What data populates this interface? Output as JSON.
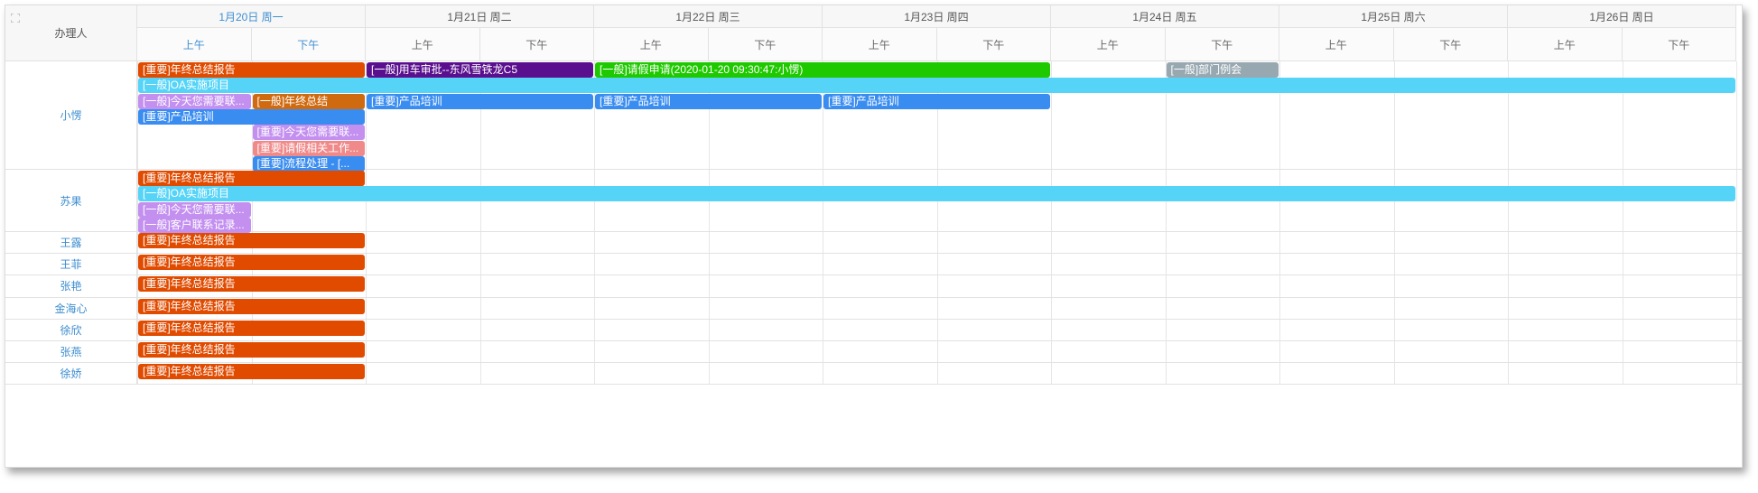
{
  "header": {
    "assignee_label": "办理人",
    "days": [
      {
        "label": "1月20日 周一",
        "today": true
      },
      {
        "label": "1月21日 周二",
        "today": false
      },
      {
        "label": "1月22日 周三",
        "today": false
      },
      {
        "label": "1月23日 周四",
        "today": false
      },
      {
        "label": "1月24日 周五",
        "today": false
      },
      {
        "label": "1月25日 周六",
        "today": false
      },
      {
        "label": "1月26日 周日",
        "today": false
      }
    ],
    "am_label": "上午",
    "pm_label": "下午"
  },
  "colors": {
    "important_orange": "#e04b00",
    "deep_purple": "#5a0f8e",
    "green": "#1fc900",
    "gray": "#97a8b0",
    "cyan": "#56d4f8",
    "lavender": "#c390f0",
    "brown_orange": "#d06a10",
    "blue": "#3a8df0",
    "pink": "#f08a8a",
    "today_blue": "#3e8ed0"
  },
  "people": [
    {
      "name": "小愣",
      "events": [
        {
          "text": "[重要]年终总结报告",
          "start": 0,
          "span": 2,
          "lane": 0,
          "color": "important_orange"
        },
        {
          "text": "[一般]用车审批--东风雪铁龙C5",
          "start": 2,
          "span": 2,
          "lane": 0,
          "color": "deep_purple"
        },
        {
          "text": "[一般]请假申请(2020-01-20 09:30:47:小愣)",
          "start": 4,
          "span": 4,
          "lane": 0,
          "color": "green"
        },
        {
          "text": "[一般]部门例会",
          "start": 9,
          "span": 1,
          "lane": 0,
          "color": "gray"
        },
        {
          "text": "[一般]OA实施项目",
          "start": 0,
          "span": 14,
          "lane": 1,
          "color": "cyan"
        },
        {
          "text": "[一般]今天您需要联...",
          "start": 0,
          "span": 1,
          "lane": 2,
          "color": "lavender"
        },
        {
          "text": "[一般]年终总结",
          "start": 1,
          "span": 1,
          "lane": 2,
          "color": "brown_orange"
        },
        {
          "text": "[重要]产品培训",
          "start": 2,
          "span": 2,
          "lane": 2,
          "color": "blue"
        },
        {
          "text": "[重要]产品培训",
          "start": 4,
          "span": 2,
          "lane": 2,
          "color": "blue"
        },
        {
          "text": "[重要]产品培训",
          "start": 6,
          "span": 2,
          "lane": 2,
          "color": "blue"
        },
        {
          "text": "[重要]产品培训",
          "start": 0,
          "span": 2,
          "lane": 3,
          "color": "blue"
        },
        {
          "text": "[重要]今天您需要联...",
          "start": 1,
          "span": 1,
          "lane": 4,
          "color": "lavender"
        },
        {
          "text": "[重要]请假相关工作...",
          "start": 1,
          "span": 1,
          "lane": 5,
          "color": "pink"
        },
        {
          "text": "[重要]流程处理 - [...",
          "start": 1,
          "span": 1,
          "lane": 6,
          "color": "blue"
        }
      ],
      "lanes": 7
    },
    {
      "name": "苏果",
      "events": [
        {
          "text": "[重要]年终总结报告",
          "start": 0,
          "span": 2,
          "lane": 0,
          "color": "important_orange"
        },
        {
          "text": "[一般]OA实施项目",
          "start": 0,
          "span": 14,
          "lane": 1,
          "color": "cyan"
        },
        {
          "text": "[一般]今天您需要联...",
          "start": 0,
          "span": 1,
          "lane": 2,
          "color": "lavender"
        },
        {
          "text": "[一般]客户联系记录...",
          "start": 0,
          "span": 1,
          "lane": 3,
          "color": "lavender"
        }
      ],
      "lanes": 4
    },
    {
      "name": "王露",
      "events": [
        {
          "text": "[重要]年终总结报告",
          "start": 0,
          "span": 2,
          "lane": 0,
          "color": "important_orange"
        }
      ],
      "lanes": 1
    },
    {
      "name": "王菲",
      "events": [
        {
          "text": "[重要]年终总结报告",
          "start": 0,
          "span": 2,
          "lane": 0,
          "color": "important_orange"
        }
      ],
      "lanes": 1
    },
    {
      "name": "张艳",
      "events": [
        {
          "text": "[重要]年终总结报告",
          "start": 0,
          "span": 2,
          "lane": 0,
          "color": "important_orange"
        }
      ],
      "lanes": 1
    },
    {
      "name": "金海心",
      "events": [
        {
          "text": "[重要]年终总结报告",
          "start": 0,
          "span": 2,
          "lane": 0,
          "color": "important_orange"
        }
      ],
      "lanes": 1
    },
    {
      "name": "徐欣",
      "events": [
        {
          "text": "[重要]年终总结报告",
          "start": 0,
          "span": 2,
          "lane": 0,
          "color": "important_orange"
        }
      ],
      "lanes": 1
    },
    {
      "name": "张燕",
      "events": [
        {
          "text": "[重要]年终总结报告",
          "start": 0,
          "span": 2,
          "lane": 0,
          "color": "important_orange"
        }
      ],
      "lanes": 1
    },
    {
      "name": "徐娇",
      "events": [
        {
          "text": "[重要]年终总结报告",
          "start": 0,
          "span": 2,
          "lane": 0,
          "color": "important_orange"
        }
      ],
      "lanes": 1
    }
  ]
}
